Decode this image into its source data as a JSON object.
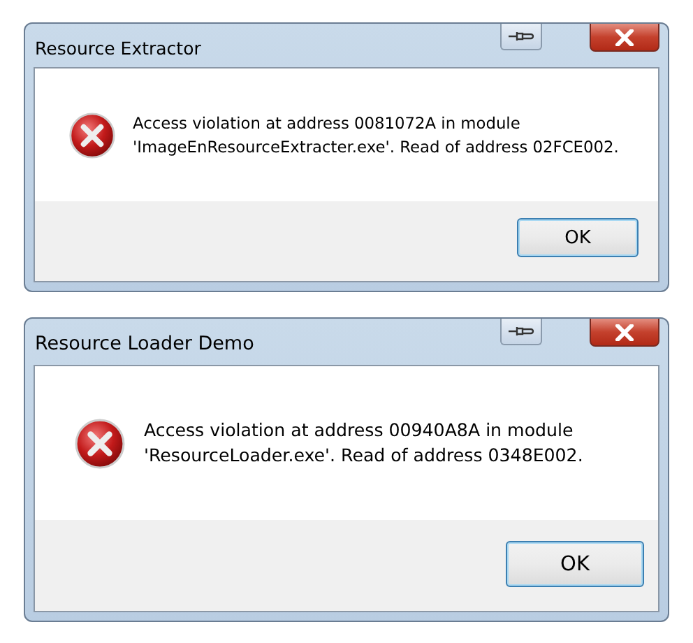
{
  "dialogs": [
    {
      "title": "Resource Extractor",
      "message_lines": [
        "Access violation at address 0081072A in module",
        "'ImageEnResourceExtracter.exe'. Read of address 02FCE002."
      ],
      "buttons": [
        "OK"
      ],
      "kind": "small"
    },
    {
      "title": "Resource Loader Demo",
      "message_lines": [
        "Access violation at address 00940A8A in module",
        "'ResourceLoader.exe'. Read of address 0348E002."
      ],
      "buttons": [
        "OK"
      ],
      "kind": "large"
    }
  ]
}
